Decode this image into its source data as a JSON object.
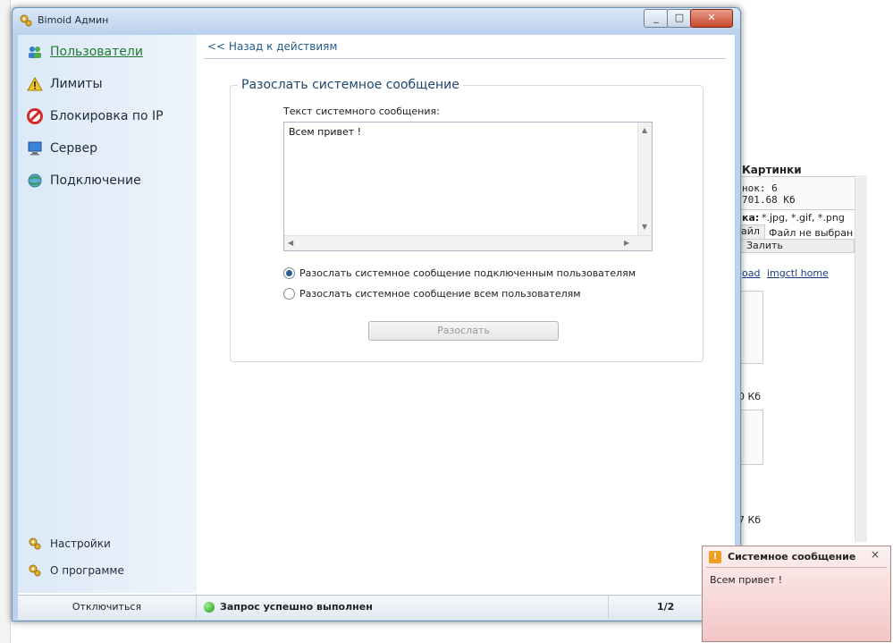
{
  "window": {
    "title": "Bimoid Админ",
    "buttons": {
      "minimize": "_",
      "maximize": "□",
      "close": "✕"
    }
  },
  "sidebar": {
    "items": [
      {
        "label": "Пользователи",
        "icon": "users-icon",
        "active": true
      },
      {
        "label": "Лимиты",
        "icon": "warning-icon"
      },
      {
        "label": "Блокировка по IP",
        "icon": "block-icon"
      },
      {
        "label": "Сервер",
        "icon": "server-icon"
      },
      {
        "label": "Подключение",
        "icon": "connection-icon"
      }
    ],
    "footer_items": [
      {
        "label": "Настройки",
        "icon": "settings-icon"
      },
      {
        "label": "О программе",
        "icon": "about-icon"
      }
    ]
  },
  "main": {
    "back_link": "<< Назад к действиям",
    "group_title": "Разослать системное сообщение",
    "message_label": "Текст системного сообщения:",
    "message_value": "Всем привет !",
    "radio_options": [
      {
        "label": "Разослать системное сообщение подключенным пользователям",
        "checked": true
      },
      {
        "label": "Разослать системное сообщение всем пользователям",
        "checked": false
      }
    ],
    "send_button": "Разослать"
  },
  "statusbar": {
    "disconnect": "Отключиться",
    "status_text": "Запрос успешно выполнен",
    "page_count": "1/2"
  },
  "popup": {
    "title": "Системное сообщение",
    "message": "Всем привет !",
    "close": "×"
  },
  "background": {
    "heading": "Картинки",
    "line1": "нок: 6",
    "line2": "701.68 Кб",
    "types_label": "ка:",
    "types_value": "*.jpg, *.gif, *.png",
    "file_button": "айл",
    "file_status": "Файл не выбран",
    "upload_button": "Залить",
    "link1": "oad",
    "link2": "imgctl home",
    "size1": "0 Кб",
    "size2": "7 Кб"
  },
  "colors": {
    "accent": "#1f7a2e",
    "link": "#1e5a8a",
    "status_ok": "#1f9a14"
  }
}
